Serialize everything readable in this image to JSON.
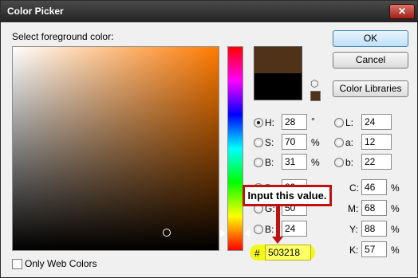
{
  "window": {
    "title": "Color Picker",
    "close": "✕"
  },
  "prompt": "Select foreground color:",
  "buttons": {
    "ok": "OK",
    "cancel": "Cancel",
    "libraries": "Color Libraries"
  },
  "colors": {
    "new": "#503218",
    "current": "#000000",
    "callout_border": "#c01010",
    "highlight": "#f4f71a"
  },
  "hsb": {
    "h": {
      "label": "H:",
      "value": "28",
      "unit": "°"
    },
    "s": {
      "label": "S:",
      "value": "70",
      "unit": "%"
    },
    "b": {
      "label": "B:",
      "value": "31",
      "unit": "%"
    }
  },
  "rgb": {
    "r": {
      "label": "R:",
      "value": "80"
    },
    "g": {
      "label": "G:",
      "value": "50"
    },
    "b": {
      "label": "B:",
      "value": "24"
    }
  },
  "lab": {
    "l": {
      "label": "L:",
      "value": "24"
    },
    "a": {
      "label": "a:",
      "value": "12"
    },
    "b": {
      "label": "b:",
      "value": "22"
    }
  },
  "cmyk": {
    "c": {
      "label": "C:",
      "value": "46",
      "unit": "%"
    },
    "m": {
      "label": "M:",
      "value": "68",
      "unit": "%"
    },
    "y": {
      "label": "Y:",
      "value": "88",
      "unit": "%"
    },
    "k": {
      "label": "K:",
      "value": "57",
      "unit": "%"
    }
  },
  "hex": {
    "label": "#",
    "value": "503218"
  },
  "callout": "Input this value.",
  "web_colors": "Only Web Colors",
  "icons": {
    "gamut": "cube-icon",
    "websafe": "websafe-swatch-icon"
  }
}
